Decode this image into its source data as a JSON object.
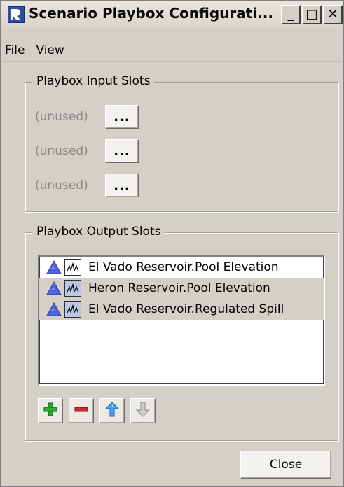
{
  "window": {
    "title": "Scenario Playbox Configurati...",
    "controls": {
      "minimize": "_",
      "maximize": "□",
      "close": "✕"
    }
  },
  "menu": [
    {
      "label": "File"
    },
    {
      "label": "View"
    }
  ],
  "input_slots": {
    "title": "Playbox Input Slots",
    "rows": [
      {
        "label": "(unused)",
        "button": "..."
      },
      {
        "label": "(unused)",
        "button": "..."
      },
      {
        "label": "(unused)",
        "button": "..."
      }
    ]
  },
  "output_slots": {
    "title": "Playbox Output Slots",
    "items": [
      {
        "label": "El Vado Reservoir.Pool Elevation",
        "icon": "chart-icon"
      },
      {
        "label": "Heron Reservoir.Pool Elevation",
        "icon": "chart-icon"
      },
      {
        "label": "El Vado Reservoir.Regulated Spill",
        "icon": "chart-icon"
      }
    ]
  },
  "toolbar": {
    "add": "add-icon",
    "remove": "remove-icon",
    "up": "arrow-up-icon",
    "down": "arrow-down-icon"
  },
  "footer": {
    "close_label": "Close"
  },
  "colors": {
    "window_bg": "#d4d0c8",
    "accent_blue": "#2a4ea5",
    "triangle_blue": "#4f63d8",
    "add_green": "#2faa2f",
    "remove_red": "#d22a2a"
  }
}
